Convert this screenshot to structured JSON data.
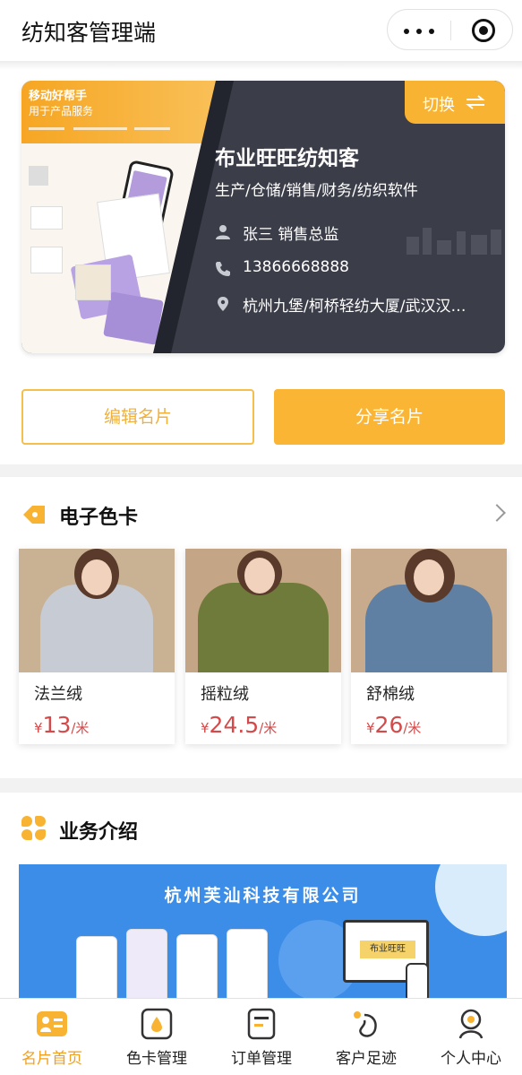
{
  "header": {
    "title": "纺知客管理端",
    "menu_icon": "more-dots-icon",
    "close_icon": "target-circle-icon"
  },
  "card": {
    "promo_title": "移动好帮手",
    "promo_subtitle": "用于产品服务",
    "switch_label": "切换",
    "company": "布业旺旺纺知客",
    "tags": "生产/仓储/销售/财务/纺织软件",
    "person": "张三 销售总监",
    "phone": "13866668888",
    "address": "杭州九堡/柯桥轻纺大厦/武汉汉…",
    "edit_label": "编辑名片",
    "share_label": "分享名片",
    "accent": "#f8b332"
  },
  "colorcard": {
    "title": "电子色卡",
    "products": [
      {
        "name": "法兰绒",
        "yen": "¥",
        "price": "13",
        "unit": "/米"
      },
      {
        "name": "摇粒绒",
        "yen": "¥",
        "price": "24.5",
        "unit": "/米"
      },
      {
        "name": "舒棉绒",
        "yen": "¥",
        "price": "26",
        "unit": "/米"
      }
    ]
  },
  "business": {
    "title": "业务介绍",
    "banner_title": "杭州芙汕科技有限公司",
    "monitor_logo": "布业旺旺"
  },
  "tabbar": {
    "tabs": [
      {
        "label": "名片首页",
        "icon": "card-home-icon"
      },
      {
        "label": "色卡管理",
        "icon": "color-card-icon"
      },
      {
        "label": "订单管理",
        "icon": "order-icon"
      },
      {
        "label": "客户足迹",
        "icon": "footprint-icon"
      },
      {
        "label": "个人中心",
        "icon": "profile-icon"
      }
    ]
  }
}
